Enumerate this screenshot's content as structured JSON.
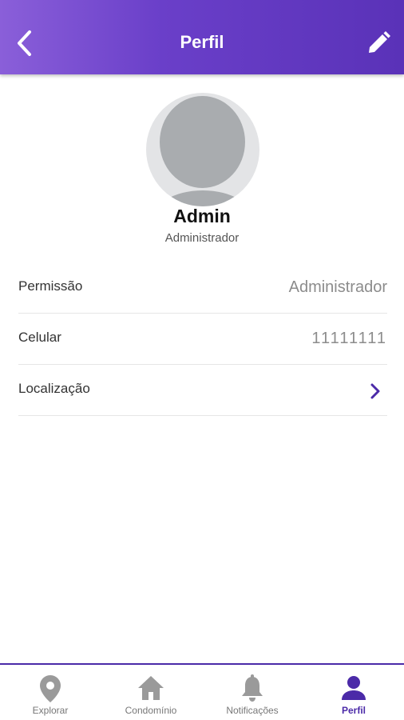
{
  "header": {
    "title": "Perfil",
    "back_icon": "chevron-left-icon",
    "edit_icon": "pencil-icon"
  },
  "profile": {
    "name": "Admin",
    "role": "Administrador"
  },
  "details": [
    {
      "label": "Permissão",
      "value": "Administrador"
    },
    {
      "label": "Celular",
      "value": "11111111"
    },
    {
      "label": "Localização",
      "value": ""
    }
  ],
  "bottom_nav": {
    "items": [
      {
        "label": "Explorar",
        "icon": "map-pin-icon",
        "active": false
      },
      {
        "label": "Condomínio",
        "icon": "home-icon",
        "active": false
      },
      {
        "label": "Notificações",
        "icon": "bell-icon",
        "active": false
      },
      {
        "label": "Perfil",
        "icon": "person-icon",
        "active": true
      }
    ]
  },
  "colors": {
    "header_gradient_start": "#8a5fd9",
    "header_gradient_end": "#5a32b8",
    "accent": "#4b2aa8",
    "avatar_fg": "#a9acaf",
    "avatar_bg": "#e3e4e6"
  }
}
